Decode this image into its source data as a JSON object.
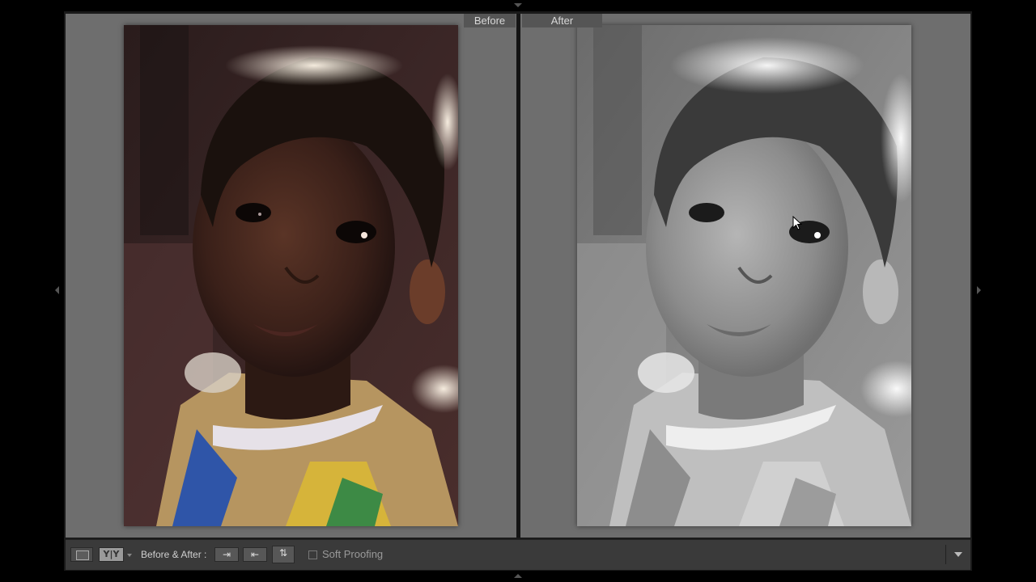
{
  "view": {
    "before_label": "Before",
    "after_label": "After"
  },
  "toolbar": {
    "loupe_icon": "loupe-view-icon",
    "yy_label": "Y|Y",
    "before_after_label": "Before & After :",
    "swap_icon_1": "copy-before-to-after-icon",
    "swap_icon_2": "copy-after-to-before-icon",
    "swap_icon_3": "swap-before-after-icon",
    "soft_proofing_label": "Soft Proofing",
    "soft_proofing_checked": false,
    "menu_icon": "chevron-down-icon"
  },
  "colors": {
    "panel": "#6e6e6e",
    "toolbar": "#3a3a3a",
    "label_bg": "#555555"
  }
}
